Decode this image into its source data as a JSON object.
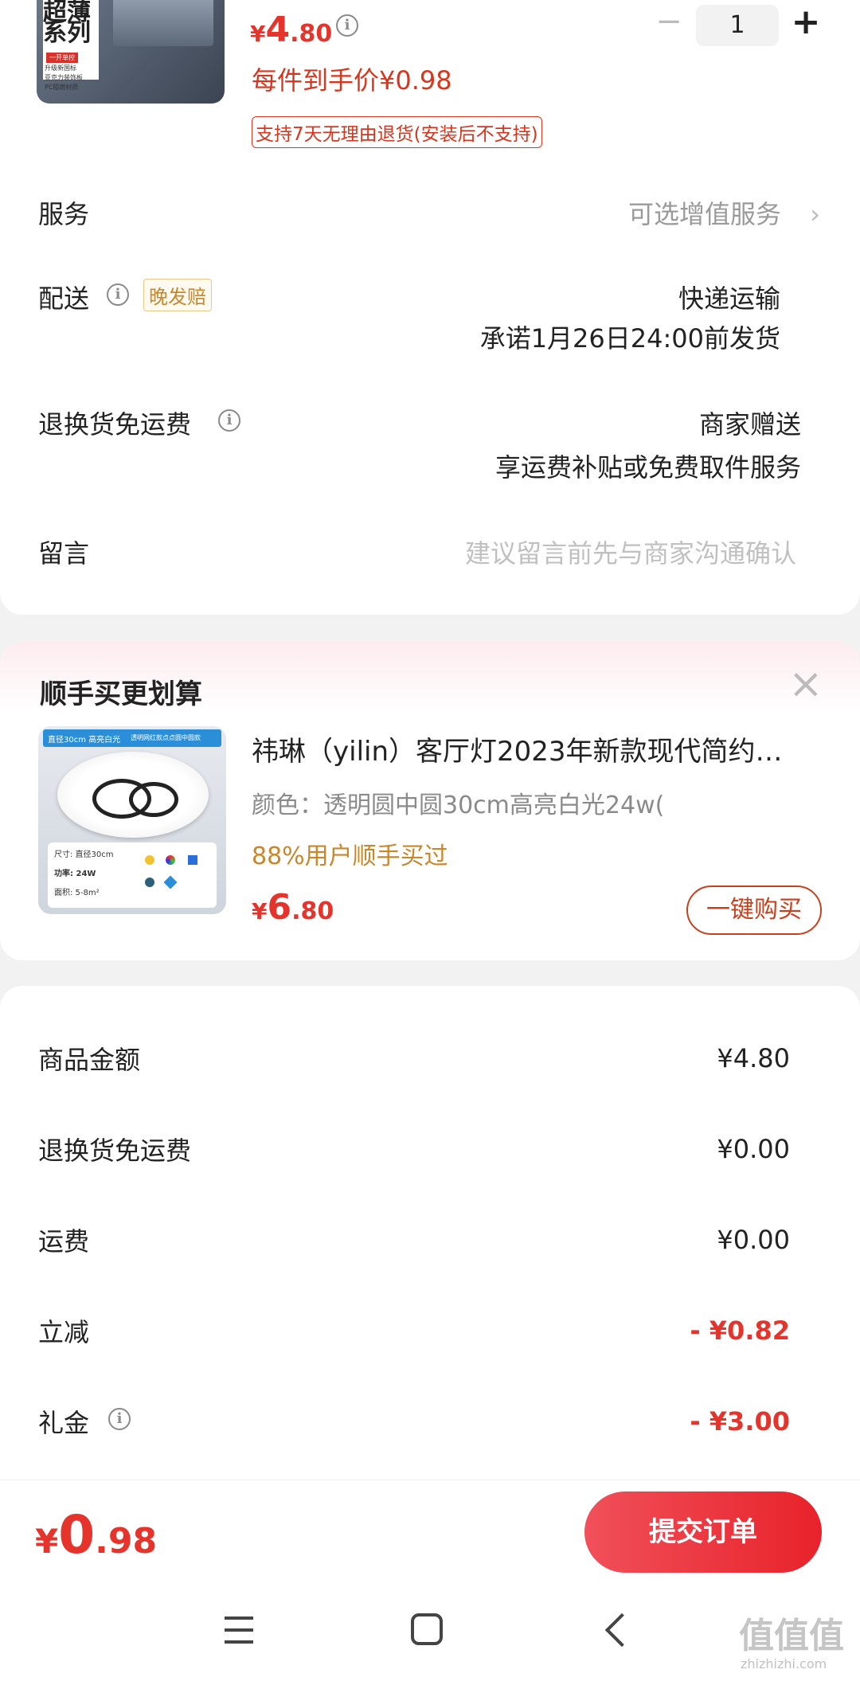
{
  "product": {
    "thumb_text_line1": "超薄",
    "thumb_text_line2": "系列",
    "thumb_tag": "一开单控",
    "thumb_feature1": "升级新国标",
    "thumb_feature2": "亚克力装饰板",
    "thumb_feature3": "PC阻燃材质",
    "price_symbol": "¥",
    "price_int": "4",
    "price_dec": ".80",
    "per_price": "每件到手价¥0.98",
    "return_tag": "支持7天无理由退货(安装后不支持)",
    "qty": "1",
    "minus": "−",
    "plus": "+"
  },
  "rows": {
    "service_label": "服务",
    "service_value": "可选增值服务",
    "delivery_label": "配送",
    "delivery_badge": "晚发赔",
    "delivery_value1": "快递运输",
    "delivery_value2": "承诺1月26日24:00前发货",
    "return_label": "退换货免运费",
    "return_value1": "商家赠送",
    "return_value2": "享运费补贴或免费取件服务",
    "message_label": "留言",
    "message_placeholder": "建议留言前先与商家沟通确认"
  },
  "recommend": {
    "title": "顺手买更划算",
    "close": "×",
    "img_badge_left": "直径30cm 高亮白光",
    "img_badge_right": "透明网红款点点圆中圆款",
    "img_spec1": "尺寸: 直径30cm",
    "img_spec2": "功率: 24W",
    "img_spec3": "面积: 5-8m²",
    "name": "祎琳（yilin）客厅灯2023年新款现代简约…",
    "variant": "颜色：透明圆中圆30cm高亮白光24w(",
    "social": "88%用户顺手买过",
    "price_symbol": "¥",
    "price_int": "6",
    "price_dec": ".80",
    "buy_button": "一键购买"
  },
  "summary": {
    "items": [
      {
        "label": "商品金额",
        "value": "¥4.80"
      },
      {
        "label": "退换货免运费",
        "value": "¥0.00"
      },
      {
        "label": "运费",
        "value": "¥0.00"
      },
      {
        "label": "立减",
        "value": "- ¥0.82"
      },
      {
        "label": "礼金",
        "value": "- ¥3.00"
      }
    ]
  },
  "footer": {
    "total_symbol": "¥",
    "total_int": "0",
    "total_dec": ".98",
    "submit": "提交订单"
  },
  "watermark": {
    "main": "值值值",
    "domain": "zhizhizhi.com"
  },
  "colors": {
    "accent_red": "#e4342c",
    "orange": "#c8872a",
    "submit_gradient": [
      "#f0505a",
      "#e8222a"
    ]
  }
}
